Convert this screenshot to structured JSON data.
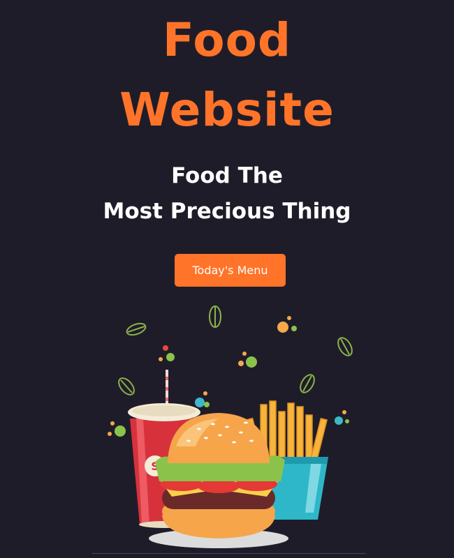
{
  "hero": {
    "title_line1": "Food",
    "title_line2": "Website",
    "tagline_line1": "Food The",
    "tagline_line2": "Most Precious Thing",
    "cta_label": "Today's Menu"
  },
  "illustration": {
    "items": [
      "soda-cup",
      "burger",
      "fries",
      "leaves",
      "dots"
    ]
  },
  "colors": {
    "background": "#1f1c2a",
    "accent": "#ff7429",
    "text": "#ffffff"
  }
}
